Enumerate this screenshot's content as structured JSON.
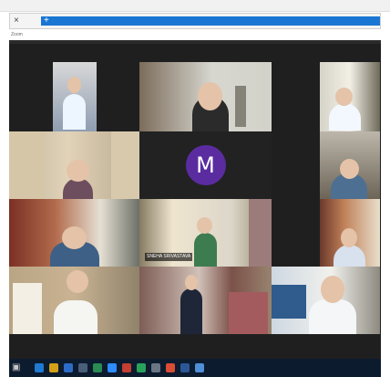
{
  "browser": {
    "close_icon": "×",
    "add_icon": "+",
    "small_label": "Zoom"
  },
  "meeting": {
    "avatar_initial": "M",
    "name_tag": "SNEHA SRIVASTAVA"
  },
  "taskbar": {
    "start_icon": "▣",
    "icons": [
      "",
      "",
      "",
      "",
      "",
      "",
      "",
      "",
      "",
      "",
      "",
      "",
      ""
    ]
  },
  "colors": {
    "avatar": "#5b2ca0",
    "address_bar": "#1976d2",
    "taskbar": "#0d1b2e"
  }
}
